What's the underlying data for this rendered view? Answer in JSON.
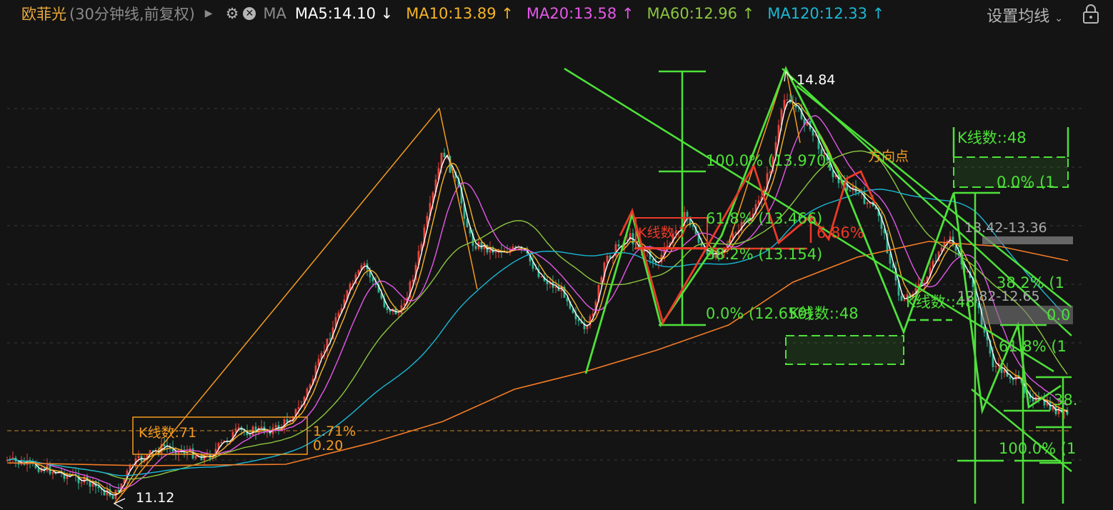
{
  "header": {
    "stock_name": "欧菲光",
    "period": "(30分钟线,前复权)",
    "ma_label": "MA",
    "settings": "设置均线",
    "ma": [
      {
        "label": "MA5:14.10",
        "arrow": "↓",
        "color": "#ffffff"
      },
      {
        "label": "MA10:13.89",
        "arrow": "↑",
        "color": "#f5b427"
      },
      {
        "label": "MA20:13.58",
        "arrow": "↑",
        "color": "#e458e8"
      },
      {
        "label": "MA60:12.96",
        "arrow": "↑",
        "color": "#8cc63f"
      },
      {
        "label": "MA120:12.33",
        "arrow": "↑",
        "color": "#1ab8d6"
      }
    ]
  },
  "chart_data": {
    "type": "candlestick",
    "y_range": [
      10.9,
      14.95
    ],
    "annotations": {
      "high_label": "14.84",
      "low_label": "11.12",
      "kline_box": "K线数:71",
      "kline_pct": "1.71%",
      "kline_diff": "0.20",
      "fib_100": "100.0% (13.970)",
      "fib_618": "61.8% (13.466)",
      "fib_382": "38.2% (13.154)",
      "fib_0": "0.0% (12.650)",
      "kline_48_a": "K线数::48",
      "kline_48_b": "K线数::48",
      "kline_red": "K线数:7",
      "red_pct": "6.86%",
      "direction_point": "方向点",
      "right_0": "0.0% (1",
      "right_382": "38.2% (1",
      "right_618": "61.8% (1",
      "right_100": "100.0% (1",
      "right_38": "38.",
      "right_00": "0.0",
      "kline_right": "K线数::48",
      "range_a": "13.42-13.36",
      "range_b": "12.82-12.65"
    }
  }
}
